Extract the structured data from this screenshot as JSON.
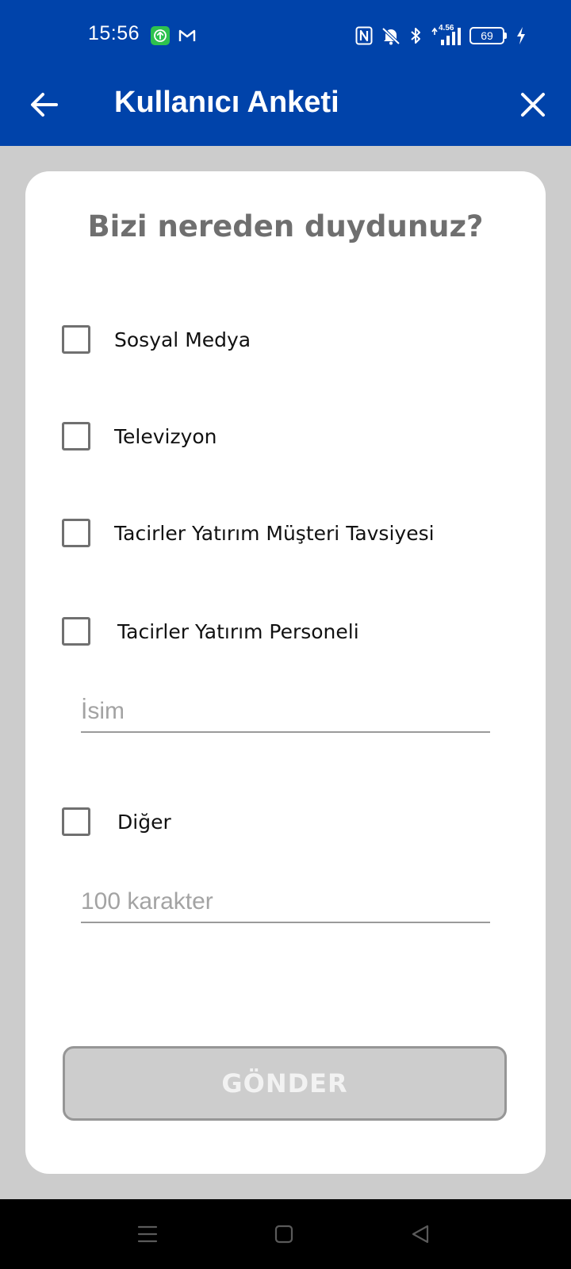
{
  "status_bar": {
    "time": "15:56",
    "network_speed": "4.56",
    "battery_level": "69",
    "icons": [
      "upload-app-icon",
      "gmail-icon",
      "nfc-icon",
      "mute-icon",
      "bluetooth-icon",
      "signal-icon",
      "battery-icon",
      "charging-icon"
    ]
  },
  "app_bar": {
    "title": "Kullanıcı Anketi",
    "back_icon": "arrow-left-icon",
    "close_icon": "close-icon"
  },
  "survey": {
    "question": "Bizi nereden duydunuz?",
    "options": [
      {
        "label": "Sosyal Medya",
        "checked": false
      },
      {
        "label": "Televizyon",
        "checked": false
      },
      {
        "label": "Tacirler Yatırım Müşteri Tavsiyesi",
        "checked": false
      },
      {
        "label": "Tacirler Yatırım Personeli",
        "checked": false
      },
      {
        "label": "Diğer",
        "checked": false
      }
    ],
    "name_field": {
      "value": "",
      "placeholder": "İsim"
    },
    "other_field": {
      "value": "",
      "placeholder": "100 karakter"
    },
    "submit_label": "GÖNDER",
    "submit_enabled": false
  },
  "nav_bar": {
    "icons": [
      "menu-icon",
      "home-icon",
      "back-triangle-icon"
    ]
  },
  "colors": {
    "primary": "#0043aa",
    "background": "#cccccc",
    "card": "#ffffff",
    "question_text": "#6f6f6f",
    "disabled_button": "#cdcdcd"
  }
}
